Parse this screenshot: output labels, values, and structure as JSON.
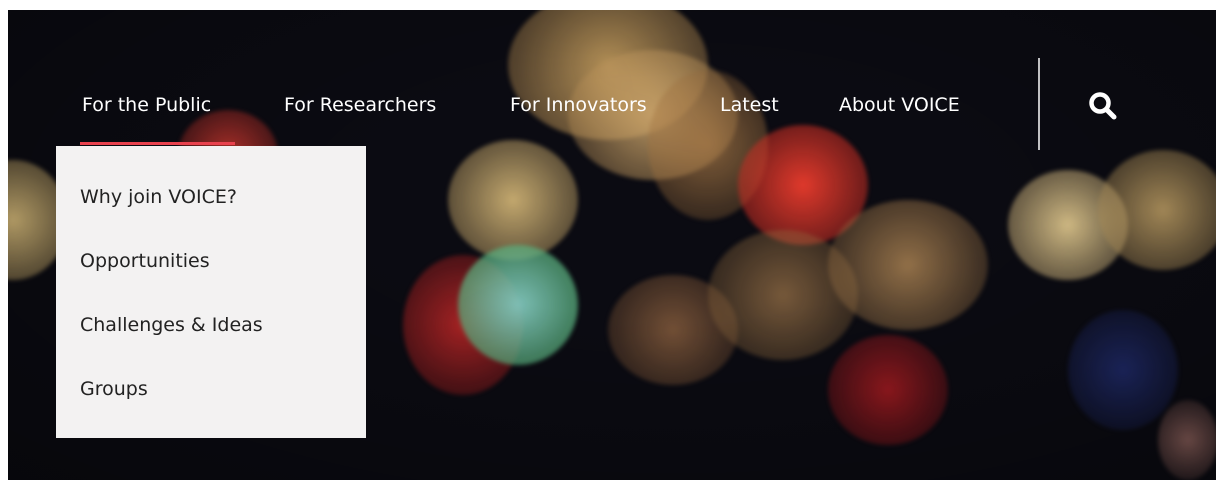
{
  "nav": {
    "items": [
      {
        "label": "For the Public",
        "active": true
      },
      {
        "label": "For Researchers"
      },
      {
        "label": "For Innovators"
      },
      {
        "label": "Latest"
      },
      {
        "label": "About VOICE"
      }
    ],
    "search_icon": "search-icon"
  },
  "dropdown": {
    "items": [
      {
        "label": "Why join VOICE?"
      },
      {
        "label": "Opportunities"
      },
      {
        "label": "Challenges & Ideas"
      },
      {
        "label": "Groups"
      }
    ]
  },
  "colors": {
    "accent": "#e8424e",
    "dropdown_bg": "#f3f2f2",
    "nav_text": "#ffffff",
    "dropdown_text": "#222222",
    "background": "#0b0b12"
  }
}
